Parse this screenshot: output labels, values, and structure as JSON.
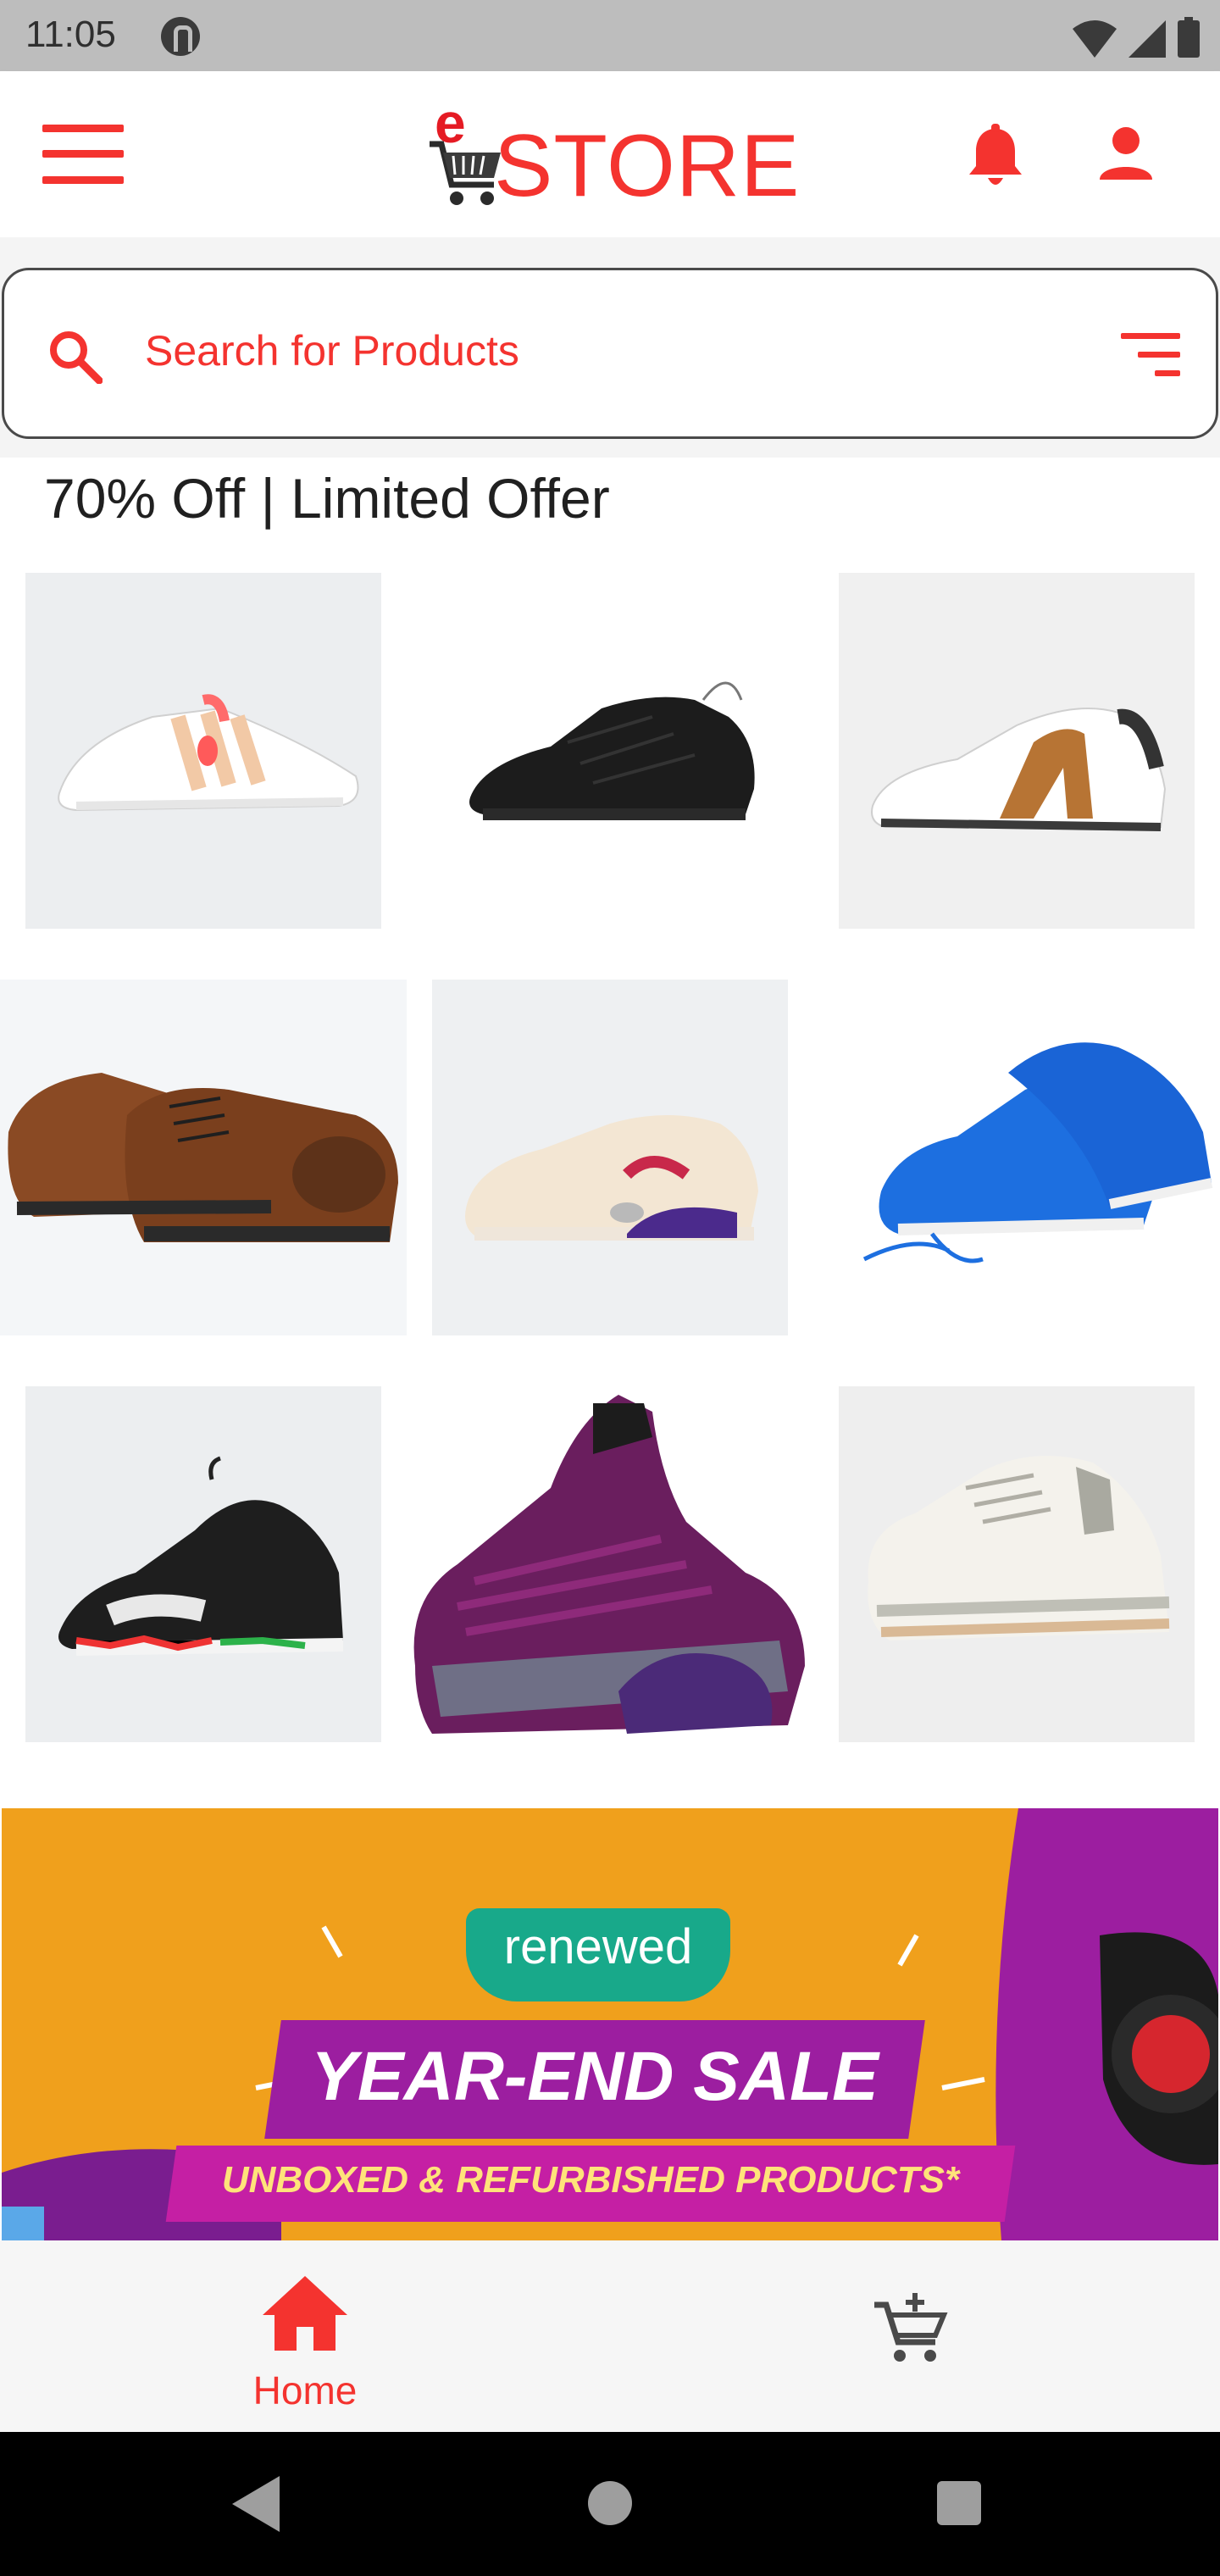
{
  "status_bar": {
    "time": "11:05"
  },
  "app_bar": {
    "logo_prefix": "e",
    "logo_text": "STORE",
    "icons": [
      "menu-icon",
      "cart-logo-icon",
      "bell-icon",
      "person-icon"
    ]
  },
  "search": {
    "placeholder": "Search for Products"
  },
  "section": {
    "title": "70% Off | Limited Offer"
  },
  "products": [
    {
      "name": "white sneaker with peach stripes"
    },
    {
      "name": "black knit running shoe"
    },
    {
      "name": "white trainer with bronze panel"
    },
    {
      "name": "brown leather oxford shoes"
    },
    {
      "name": "cream air sneaker with purple sole"
    },
    {
      "name": "blue running shoes"
    },
    {
      "name": "black basketball sneaker"
    },
    {
      "name": "purple knit slip-on shoes"
    },
    {
      "name": "white retro sneaker"
    }
  ],
  "banner": {
    "tag": "renewed",
    "title": "YEAR-END SALE",
    "subtitle": "UNBOXED & REFURBISHED PRODUCTS*"
  },
  "bottom_nav": {
    "home_label": "Home"
  },
  "colors": {
    "accent": "#f4332f",
    "banner_bg": "#f0a01c",
    "banner_purple": "#9c1ea0"
  }
}
